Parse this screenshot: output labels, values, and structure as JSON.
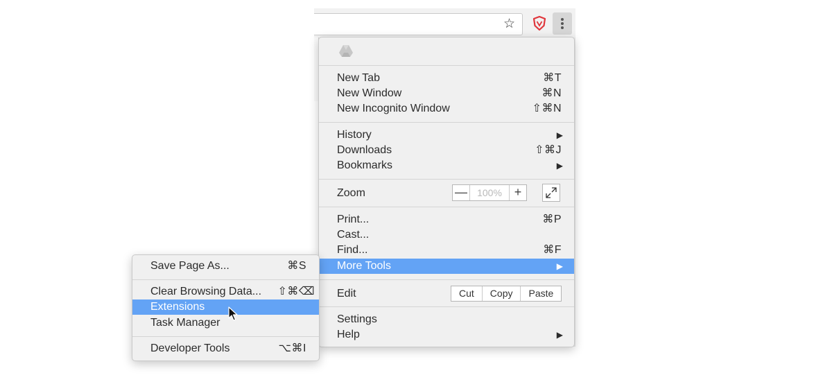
{
  "toolbar": {
    "star_icon": "☆",
    "shield_icon": "shield-icon",
    "menu_icon": "three-dots-vertical-icon"
  },
  "main_menu": {
    "header_icon": "drive-icon",
    "new_tab": {
      "label": "New Tab",
      "shortcut": "⌘T"
    },
    "new_window": {
      "label": "New Window",
      "shortcut": "⌘N"
    },
    "new_incognito": {
      "label": "New Incognito Window",
      "shortcut": "⇧⌘N"
    },
    "history": {
      "label": "History",
      "arrow": "▶"
    },
    "downloads": {
      "label": "Downloads",
      "shortcut": "⇧⌘J"
    },
    "bookmarks": {
      "label": "Bookmarks",
      "arrow": "▶"
    },
    "zoom": {
      "label": "Zoom",
      "minus": "—",
      "value": "100%",
      "plus": "+"
    },
    "print": {
      "label": "Print...",
      "shortcut": "⌘P"
    },
    "cast": {
      "label": "Cast..."
    },
    "find": {
      "label": "Find...",
      "shortcut": "⌘F"
    },
    "more_tools": {
      "label": "More Tools",
      "arrow": "▶"
    },
    "edit": {
      "label": "Edit",
      "cut": "Cut",
      "copy": "Copy",
      "paste": "Paste"
    },
    "settings": {
      "label": "Settings"
    },
    "help": {
      "label": "Help",
      "arrow": "▶"
    }
  },
  "sub_menu": {
    "save_page": {
      "label": "Save Page As...",
      "shortcut": "⌘S"
    },
    "clear_data": {
      "label": "Clear Browsing Data...",
      "shortcut": "⇧⌘⌫"
    },
    "extensions": {
      "label": "Extensions"
    },
    "task_manager": {
      "label": "Task Manager"
    },
    "developer_tools": {
      "label": "Developer Tools",
      "shortcut": "⌥⌘I"
    }
  },
  "colors": {
    "highlight": "#63a3f5",
    "menu_bg": "#f0f0f0",
    "shield": "#e0353b"
  }
}
